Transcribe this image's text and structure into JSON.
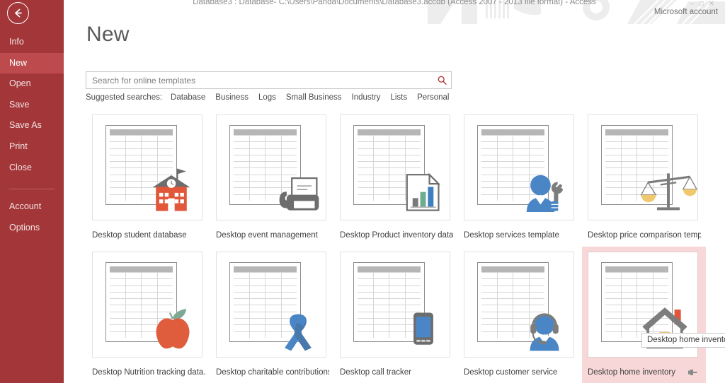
{
  "window": {
    "title": "Database3 : Database- C:\\Users\\Panda\\Documents\\Database3.accdb (Access 2007 - 2013 file format) - Access",
    "account_label": "Microsoft account",
    "minimize": "–",
    "restore": "□",
    "close": "✕"
  },
  "sidebar": {
    "back_icon": "back-arrow-icon",
    "items": [
      {
        "label": "Info",
        "active": false
      },
      {
        "label": "New",
        "active": true
      },
      {
        "label": "Open",
        "active": false
      },
      {
        "label": "Save",
        "active": false
      },
      {
        "label": "Save As",
        "active": false
      },
      {
        "label": "Print",
        "active": false
      },
      {
        "label": "Close",
        "active": false
      }
    ],
    "footer_items": [
      {
        "label": "Account"
      },
      {
        "label": "Options"
      }
    ],
    "background_color": "#a33639",
    "active_color": "#bd4b4e"
  },
  "main": {
    "page_title": "New",
    "search": {
      "placeholder": "Search for online templates",
      "value": "",
      "button_icon": "search-icon",
      "icon_color": "#b03030"
    },
    "suggested": {
      "label": "Suggested searches:",
      "links": [
        "Database",
        "Business",
        "Logs",
        "Small Business",
        "Industry",
        "Lists",
        "Personal"
      ]
    },
    "templates": [
      {
        "label": "Desktop student database",
        "art": "schoolhouse",
        "selected": false,
        "pinned": false
      },
      {
        "label": "Desktop event management",
        "art": "fax-machine",
        "selected": false,
        "pinned": false
      },
      {
        "label": "Desktop Product inventory data...",
        "art": "chart-doc",
        "selected": false,
        "pinned": false
      },
      {
        "label": "Desktop services template",
        "art": "person-wrench",
        "selected": false,
        "pinned": false
      },
      {
        "label": "Desktop price comparison templ...",
        "art": "scales",
        "selected": false,
        "pinned": false
      },
      {
        "label": "Desktop Nutrition tracking data...",
        "art": "apple",
        "selected": false,
        "pinned": false
      },
      {
        "label": "Desktop charitable contributions",
        "art": "ribbon",
        "selected": false,
        "pinned": false
      },
      {
        "label": "Desktop call tracker",
        "art": "mobile-phone",
        "selected": false,
        "pinned": false
      },
      {
        "label": "Desktop customer service",
        "art": "headset-person",
        "selected": false,
        "pinned": false
      },
      {
        "label": "Desktop home inventory",
        "art": "house",
        "selected": true,
        "pinned": true
      }
    ],
    "tooltip": {
      "text": "Desktop home inventory",
      "on_card_index": 9
    },
    "selected_card_color": "#f7d7d7"
  }
}
